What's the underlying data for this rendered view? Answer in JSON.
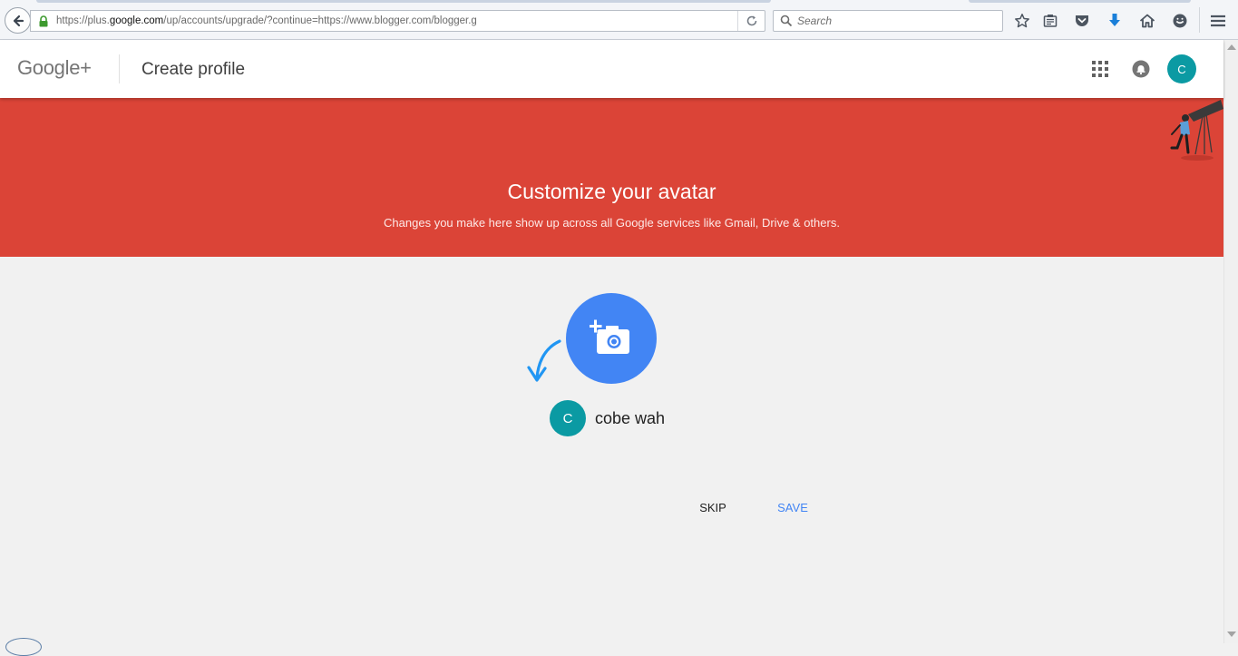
{
  "browser": {
    "url_prefix": "https://plus.",
    "url_domain": "google.com",
    "url_suffix": "/up/accounts/upgrade/?continue=https://www.blogger.com/blogger.g",
    "search_placeholder": "Search"
  },
  "header": {
    "logo_text": "Google+",
    "page_title": "Create profile",
    "avatar_initial": "C",
    "avatar_color": "#0b9aa3"
  },
  "hero": {
    "title": "Customize your avatar",
    "subtitle": "Changes you make here show up across all Google services like Gmail, Drive & others.",
    "background_color": "#db4437"
  },
  "profile": {
    "avatar_initial": "C",
    "name": "cobe wah",
    "photo_button_color": "#4285f4"
  },
  "actions": {
    "skip_label": "SKIP",
    "save_label": "SAVE"
  }
}
